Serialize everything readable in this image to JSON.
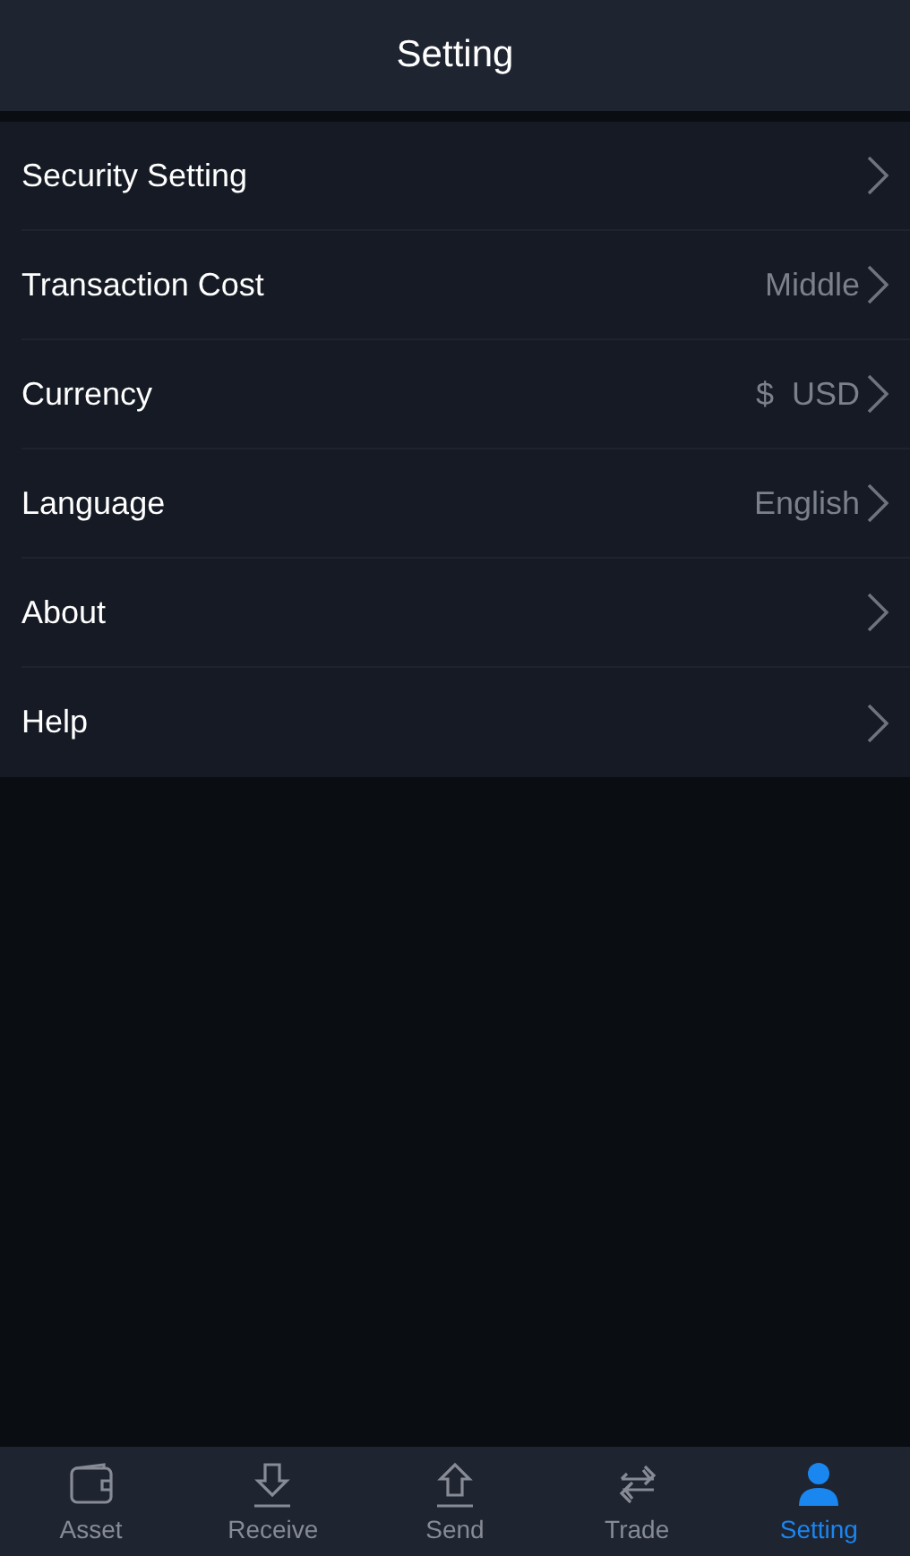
{
  "header": {
    "title": "Setting"
  },
  "items": [
    {
      "label": "Security Setting"
    },
    {
      "label": "Transaction Cost",
      "value": "Middle"
    },
    {
      "label": "Currency",
      "value": "$  USD"
    },
    {
      "label": "Language",
      "value": "English"
    },
    {
      "label": "About"
    },
    {
      "label": "Help"
    }
  ],
  "tabs": [
    {
      "kind": "wallet",
      "label": "Asset",
      "selected": false
    },
    {
      "kind": "receive",
      "label": "Receive",
      "selected": false
    },
    {
      "kind": "send",
      "label": "Send",
      "selected": false
    },
    {
      "kind": "trade",
      "label": "Trade",
      "selected": false
    },
    {
      "kind": "person",
      "label": "Setting",
      "selected": true
    }
  ]
}
